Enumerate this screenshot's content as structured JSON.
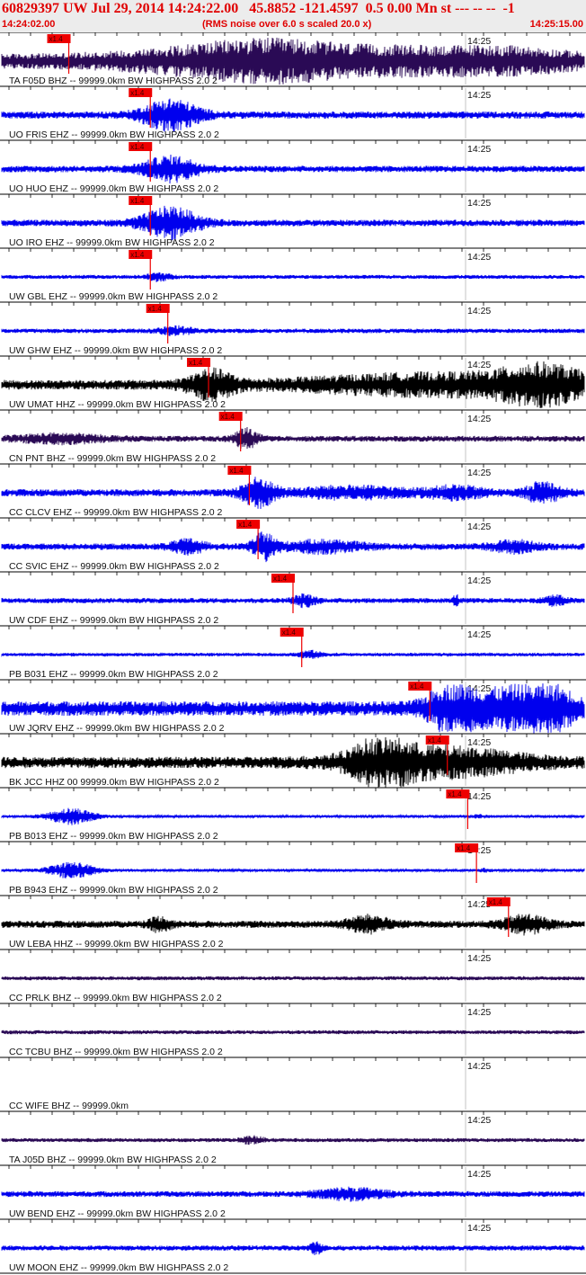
{
  "header": {
    "title": "60829397 UW Jul 29, 2014 14:24:22.00   45.8852 -121.4597  0.5 0.00 Mn st --- -- --  -1",
    "start_time": "14:24:02.00",
    "note": "(RMS noise over 6.0 s scaled 20.0 x)",
    "end_time": "14:25:15.00"
  },
  "tick_label": "14:25",
  "pick_label": "x1.4",
  "colors": {
    "blue": "#0000ee",
    "purple": "#2a0a55",
    "black": "#000000",
    "pick": "#ee0000"
  },
  "traces": [
    {
      "label": "TA F05D BHZ -- 99999.0km BW  HIGHPASS  2.0  2",
      "color": "purple",
      "amp": 0.45,
      "pick": 0.115,
      "bursts": [
        [
          0.37,
          0.2,
          0.9
        ],
        [
          0.45,
          0.14,
          0.9
        ],
        [
          0.55,
          0.18,
          0.8
        ],
        [
          0.7,
          0.1,
          0.6
        ],
        [
          0.82,
          0.1,
          0.6
        ],
        [
          0.9,
          0.12,
          0.7
        ]
      ]
    },
    {
      "label": "UO FRIS EHZ -- 99999.0km BW  HIGHPASS  2.0  2",
      "color": "blue",
      "amp": 0.22,
      "pick": 0.255,
      "bursts": [
        [
          0.29,
          0.05,
          4.0
        ]
      ]
    },
    {
      "label": "UO HUO EHZ -- 99999.0km BW  HIGHPASS  2.0  2",
      "color": "blue",
      "amp": 0.2,
      "pick": 0.255,
      "bursts": [
        [
          0.29,
          0.05,
          3.5
        ]
      ]
    },
    {
      "label": "UO IRO EHZ -- 99999.0km BW  HIGHPASS  2.0  2",
      "color": "blue",
      "amp": 0.2,
      "pick": 0.255,
      "bursts": [
        [
          0.29,
          0.05,
          4.5
        ]
      ]
    },
    {
      "label": "UW GBL EHZ -- 99999.0km BW  HIGHPASS  2.0  2",
      "color": "blue",
      "amp": 0.12,
      "pick": 0.255,
      "bursts": [
        [
          0.27,
          0.02,
          1.8
        ]
      ]
    },
    {
      "label": "UW GHW EHZ -- 99999.0km BW  HIGHPASS  2.0  2",
      "color": "blue",
      "amp": 0.14,
      "pick": 0.285,
      "bursts": [
        [
          0.3,
          0.03,
          1.5
        ]
      ]
    },
    {
      "label": "UW UMAT HHZ -- 99999.0km BW  HIGHPASS  2.0  2",
      "color": "black",
      "amp": 0.3,
      "pick": 0.355,
      "bursts": [
        [
          0.36,
          0.04,
          2.5
        ],
        [
          0.75,
          0.25,
          1.8
        ],
        [
          0.93,
          0.08,
          2.8
        ]
      ]
    },
    {
      "label": "CN PNT BHZ -- 99999.0km BW  HIGHPASS  2.0  2",
      "color": "purple",
      "amp": 0.18,
      "pick": 0.41,
      "bursts": [
        [
          0.42,
          0.02,
          3.2
        ],
        [
          0.1,
          0.08,
          1.3
        ]
      ]
    },
    {
      "label": "CC CLCV EHZ -- 99999.0km BW  HIGHPASS  2.0  2",
      "color": "blue",
      "amp": 0.22,
      "pick": 0.425,
      "bursts": [
        [
          0.44,
          0.03,
          3.6
        ],
        [
          0.6,
          0.1,
          1.4
        ],
        [
          0.78,
          0.05,
          1.5
        ],
        [
          0.93,
          0.03,
          2.8
        ]
      ]
    },
    {
      "label": "CC SVIC EHZ -- 99999.0km BW  HIGHPASS  2.0  2",
      "color": "blue",
      "amp": 0.2,
      "pick": 0.44,
      "bursts": [
        [
          0.45,
          0.02,
          3.8
        ],
        [
          0.32,
          0.03,
          1.8
        ],
        [
          0.55,
          0.07,
          1.6
        ],
        [
          0.88,
          0.04,
          1.6
        ]
      ]
    },
    {
      "label": "UW CDF EHZ -- 99999.0km BW  HIGHPASS  2.0  2",
      "color": "blue",
      "amp": 0.16,
      "pick": 0.5,
      "bursts": [
        [
          0.52,
          0.02,
          2.0
        ],
        [
          0.78,
          0.005,
          2.0
        ],
        [
          0.95,
          0.02,
          1.6
        ]
      ]
    },
    {
      "label": "PB B031 EHZ -- 99999.0km BW  HIGHPASS  2.0  2",
      "color": "blue",
      "amp": 0.1,
      "pick": 0.515,
      "bursts": [
        [
          0.53,
          0.02,
          2.0
        ]
      ]
    },
    {
      "label": "UW JQRV EHZ -- 99999.0km BW  HIGHPASS  2.0  2",
      "color": "blue",
      "amp": 0.45,
      "pick": 0.735,
      "bursts": [
        [
          0.77,
          0.04,
          2.5
        ],
        [
          0.86,
          0.08,
          2.0
        ],
        [
          0.94,
          0.05,
          2.2
        ]
      ]
    },
    {
      "label": "BK JCC HHZ 00 99999.0km BW  HIGHPASS  2.0  2",
      "color": "black",
      "amp": 0.35,
      "pick": 0.765,
      "bursts": [
        [
          0.65,
          0.05,
          2.8
        ],
        [
          0.75,
          0.15,
          2.2
        ]
      ]
    },
    {
      "label": "PB B013 EHZ -- 99999.0km BW  HIGHPASS  2.0  2",
      "color": "blue",
      "amp": 0.08,
      "pick": 0.8,
      "bursts": [
        [
          0.12,
          0.04,
          6.0
        ],
        [
          0.82,
          0.01,
          1.2
        ]
      ]
    },
    {
      "label": "PB B943 EHZ -- 99999.0km BW  HIGHPASS  2.0  2",
      "color": "blue",
      "amp": 0.08,
      "pick": 0.815,
      "bursts": [
        [
          0.12,
          0.04,
          6.0
        ],
        [
          0.83,
          0.01,
          1.2
        ]
      ]
    },
    {
      "label": "UW LEBA HHZ -- 99999.0km BW  HIGHPASS  2.0  2",
      "color": "black",
      "amp": 0.22,
      "pick": 0.87,
      "bursts": [
        [
          0.63,
          0.04,
          2.0
        ],
        [
          0.27,
          0.02,
          1.6
        ],
        [
          0.9,
          0.04,
          2.2
        ]
      ]
    },
    {
      "label": "CC PRLK BHZ -- 99999.0km BW  HIGHPASS  2.0  2",
      "color": "purple",
      "amp": 0.12,
      "pick": null,
      "bursts": []
    },
    {
      "label": "CC TCBU BHZ -- 99999.0km BW  HIGHPASS  2.0  2",
      "color": "purple",
      "amp": 0.12,
      "pick": null,
      "bursts": []
    },
    {
      "label": "CC WIFE BHZ -- 99999.0km",
      "color": "none",
      "amp": 0,
      "pick": null,
      "bursts": []
    },
    {
      "label": "TA J05D BHZ -- 99999.0km BW  HIGHPASS  2.0  2",
      "color": "purple",
      "amp": 0.12,
      "pick": null,
      "bursts": [
        [
          0.43,
          0.02,
          1.7
        ]
      ]
    },
    {
      "label": "UW BEND EHZ -- 99999.0km BW  HIGHPASS  2.0  2",
      "color": "blue",
      "amp": 0.18,
      "pick": null,
      "bursts": [
        [
          0.6,
          0.06,
          1.7
        ]
      ]
    },
    {
      "label": "UW MOON EHZ -- 99999.0km BW  HIGHPASS  2.0  2",
      "color": "blue",
      "amp": 0.16,
      "pick": null,
      "bursts": [
        [
          0.54,
          0.01,
          2.0
        ]
      ]
    }
  ]
}
